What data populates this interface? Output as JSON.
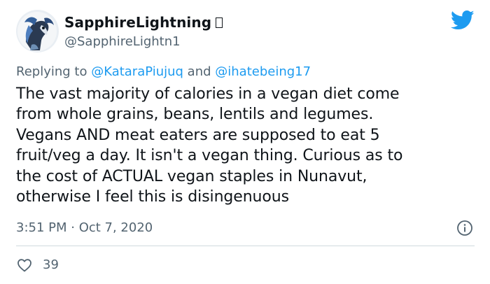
{
  "tweet": {
    "display_name": "SapphireLightning",
    "handle": "@SapphireLightn1",
    "replying_prefix": "Replying to ",
    "reply_mention_1": "@KataraPiujuq",
    "reply_conjunction": " and ",
    "reply_mention_2": "@ihatebeing17",
    "text": "The vast majority of calories in a vegan diet come\nfrom whole grains, beans, lentils and legumes.\nVegans AND meat eaters are supposed to eat 5\nfruit/veg a day. It isn't a vegan thing. Curious as to\nthe cost of ACTUAL vegan staples in Nunavut,\notherwise I feel this is disingenuous",
    "timestamp": "3:51 PM · Oct 7, 2020",
    "like_count": "39"
  },
  "icons": {
    "brand": "twitter-bird-icon",
    "info": "info-icon",
    "like": "heart-icon"
  },
  "colors": {
    "brand_blue": "#1d9bf0",
    "text_primary": "#0f1419",
    "text_secondary": "#536471",
    "divider": "#cfd9de"
  }
}
